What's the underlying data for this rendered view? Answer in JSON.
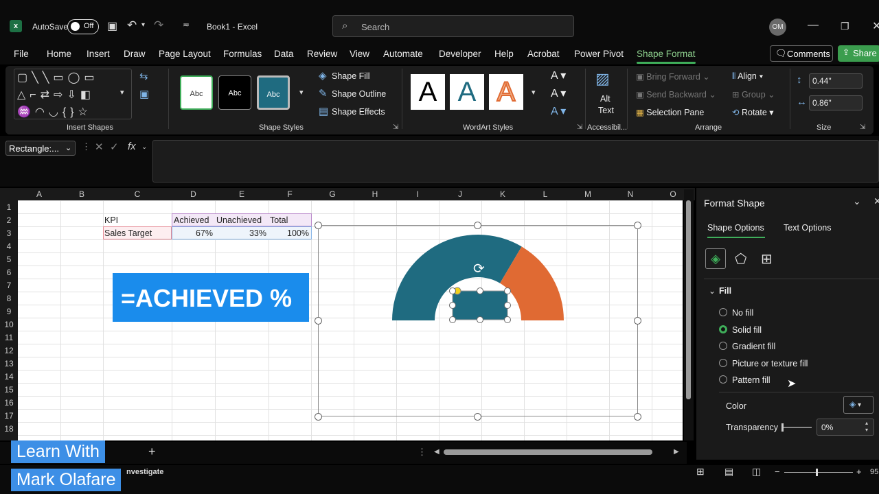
{
  "titlebar": {
    "autosave_label": "AutoSave",
    "toggle_state": "Off",
    "doc_title": "Book1  -  Excel",
    "search_placeholder": "Search",
    "avatar_initials": "OM"
  },
  "menu": {
    "items": [
      "File",
      "Home",
      "Insert",
      "Draw",
      "Page Layout",
      "Formulas",
      "Data",
      "Review",
      "View",
      "Automate",
      "Developer",
      "Help",
      "Acrobat",
      "Power Pivot",
      "Shape Format"
    ],
    "active": "Shape Format",
    "comments_label": "Comments",
    "share_label": "Share"
  },
  "ribbon": {
    "groups": {
      "insert_shapes": "Insert Shapes",
      "shape_styles": "Shape Styles",
      "wordart_styles": "WordArt Styles",
      "accessibility": "Accessibil...",
      "arrange": "Arrange",
      "size": "Size"
    },
    "shape_styles": {
      "sample": "Abc",
      "shape_fill": "Shape Fill",
      "shape_outline": "Shape Outline",
      "shape_effects": "Shape Effects"
    },
    "wordart": {
      "letter": "A"
    },
    "alt_text": [
      "Alt",
      "Text"
    ],
    "arrange": {
      "bring_forward": "Bring Forward",
      "send_backward": "Send Backward",
      "selection_pane": "Selection Pane",
      "align": "Align",
      "group": "Group",
      "rotate": "Rotate"
    },
    "size": {
      "height": "0.44\"",
      "width": "0.86\""
    }
  },
  "formula_bar": {
    "name_box": "Rectangle:...",
    "fx": "fx",
    "value": ""
  },
  "sheet": {
    "columns": [
      "A",
      "B",
      "C",
      "D",
      "E",
      "F",
      "G",
      "H",
      "I",
      "J",
      "K",
      "L",
      "M",
      "N",
      "O"
    ],
    "rows": [
      "1",
      "2",
      "3",
      "4",
      "5",
      "6",
      "7",
      "8",
      "9",
      "10",
      "11",
      "12",
      "13",
      "14",
      "15",
      "16",
      "17",
      "18"
    ],
    "table": {
      "headers": [
        "KPI",
        "Achieved",
        "Unachieved",
        "Total"
      ],
      "row": [
        "Sales Target",
        "67%",
        "33%",
        "100%"
      ]
    },
    "banner": "=ACHIEVED %",
    "gauge": {
      "achieved": 0.67,
      "unachieved": 0.33,
      "achieved_color": "#1f6b80",
      "unachieved_color": "#e06a33"
    }
  },
  "format_panel": {
    "title": "Format Shape",
    "tabs": [
      "Shape Options",
      "Text Options"
    ],
    "section": "Fill",
    "fill_options": [
      "No fill",
      "Solid fill",
      "Gradient fill",
      "Picture or texture fill",
      "Pattern fill"
    ],
    "selected": "Solid fill",
    "color_label": "Color",
    "transparency_label": "Transparency",
    "transparency_value": "0%"
  },
  "sheetbar": {
    "add": "+"
  },
  "status": {
    "investigate": "nvestigate",
    "zoom": "95"
  },
  "watermark": {
    "line1": "Learn With",
    "line2": "Mark Olafare"
  }
}
